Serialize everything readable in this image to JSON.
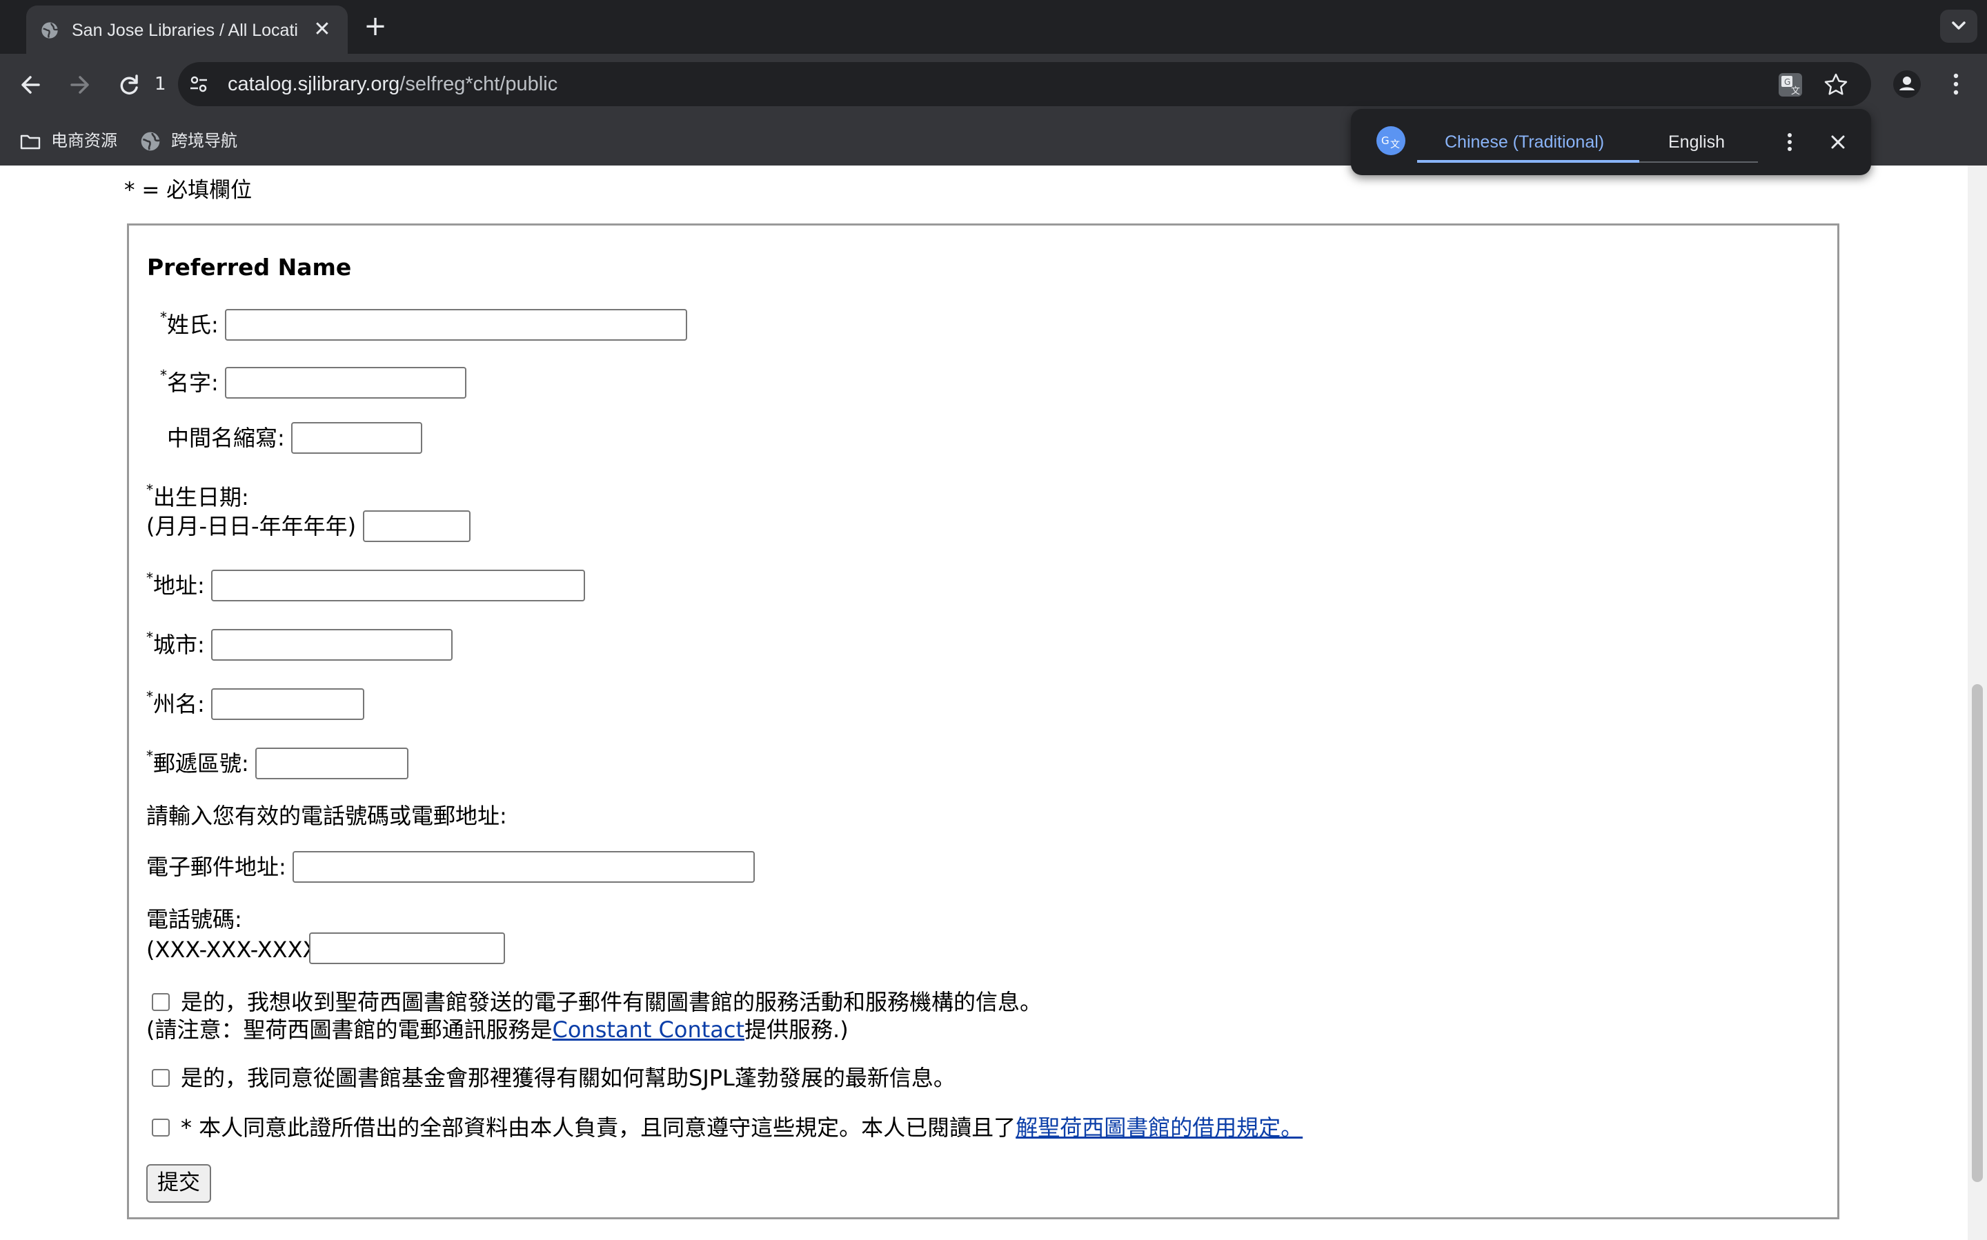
{
  "browser": {
    "tab_title": "San Jose Libraries / All Locati",
    "new_tab_label": "+",
    "reload_count": "1",
    "url_host": "catalog.sjlibrary.org",
    "url_path": "/selfreg*cht/public",
    "bookmarks": [
      {
        "label": "电商资源",
        "icon": "folder-icon"
      },
      {
        "label": "跨境导航",
        "icon": "globe-icon"
      }
    ]
  },
  "translate": {
    "source_lang": "Chinese (Traditional)",
    "target_lang": "English",
    "accent_color": "#8ab4f8"
  },
  "page": {
    "required_note": "* = 必填欄位",
    "section_title": "Preferred Name",
    "fields": {
      "last_name": "姓氏:",
      "first_name": "名字:",
      "middle_initial": "中間名縮寫:",
      "dob_label": "出生日期:",
      "dob_format": "(月月-日日-年年年年)",
      "address": "地址:",
      "city": "城市:",
      "state": "州名:",
      "zip": "郵遞區號:",
      "contact_prompt": "請輸入您有效的電話號碼或電郵地址:",
      "email": "電子郵件地址:",
      "phone_label": "電話號碼:",
      "phone_format": "(XXX-XXX-XXXX)"
    },
    "required_mark": "*",
    "checkboxes": {
      "email_opt_in": "是的，我想收到聖荷西圖書館發送的電子郵件有關圖書館的服務活動和服務機構的信息。",
      "email_note_prefix": "(請注意：聖荷西圖書館的電郵通訊服務是",
      "email_note_link": "Constant Contact",
      "email_note_suffix": "提供服務.)",
      "foundation_opt_in": "是的，我同意從圖書館基金會那裡獲得有關如何幫助SJPL蓬勃發展的最新信息。",
      "agreement_prefix": "* 本人同意此證所借出的全部資料由本人負責，且同意遵守這些規定。本人已閱讀且了",
      "agreement_link": "解聖荷西圖書館的借用規定。"
    },
    "submit_label": "提交"
  }
}
